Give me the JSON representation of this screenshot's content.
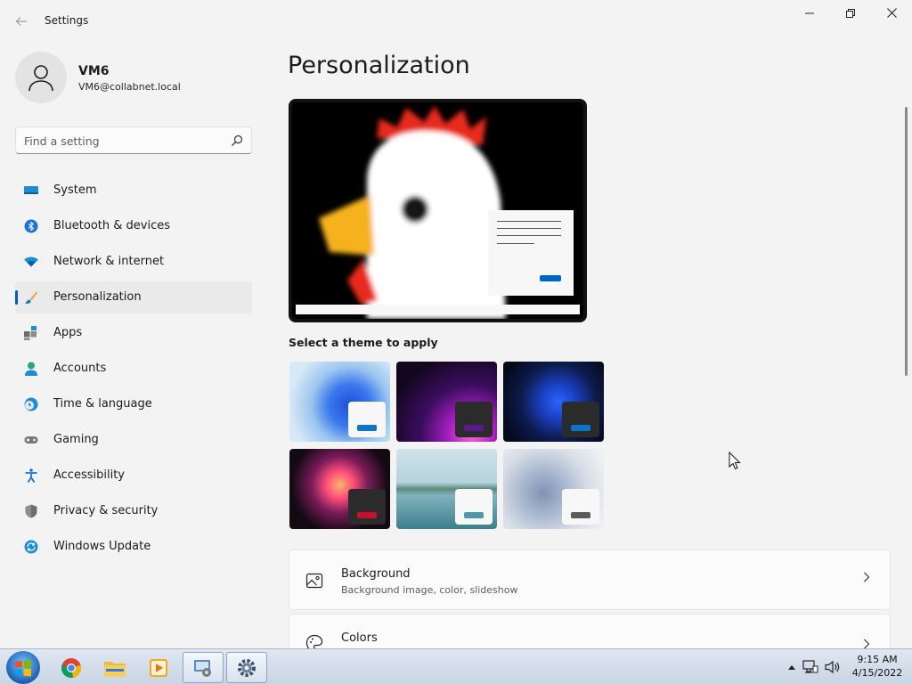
{
  "window": {
    "title": "Settings",
    "back_icon": "back-arrow-icon",
    "minimize_icon": "minimize-icon",
    "maximize_icon": "restore-icon",
    "close_icon": "close-icon"
  },
  "profile": {
    "name": "VM6",
    "email": "VM6@collabnet.local"
  },
  "search": {
    "placeholder": "Find a setting",
    "value": ""
  },
  "sidebar": {
    "items": [
      {
        "label": "System",
        "icon": "system-icon",
        "active": false
      },
      {
        "label": "Bluetooth & devices",
        "icon": "bluetooth-icon",
        "active": false
      },
      {
        "label": "Network & internet",
        "icon": "wifi-icon",
        "active": false
      },
      {
        "label": "Personalization",
        "icon": "brush-icon",
        "active": true
      },
      {
        "label": "Apps",
        "icon": "apps-icon",
        "active": false
      },
      {
        "label": "Accounts",
        "icon": "person-icon",
        "active": false
      },
      {
        "label": "Time & language",
        "icon": "clock-globe-icon",
        "active": false
      },
      {
        "label": "Gaming",
        "icon": "gamepad-icon",
        "active": false
      },
      {
        "label": "Accessibility",
        "icon": "accessibility-icon",
        "active": false
      },
      {
        "label": "Privacy & security",
        "icon": "shield-icon",
        "active": false
      },
      {
        "label": "Windows Update",
        "icon": "update-icon",
        "active": false
      }
    ]
  },
  "main": {
    "title": "Personalization",
    "theme_heading": "Select a theme to apply",
    "themes": [
      {
        "name": "theme-windows-light",
        "accent": "#0a74c9"
      },
      {
        "name": "theme-glow",
        "accent": "#5b1a8a"
      },
      {
        "name": "theme-windows-dark",
        "accent": "#0a74c9"
      },
      {
        "name": "theme-captured-motion",
        "accent": "#c8102e"
      },
      {
        "name": "theme-sunrise-lake",
        "accent": "#4a9aa8"
      },
      {
        "name": "theme-flow",
        "accent": "#5a5a5a"
      }
    ],
    "cards": [
      {
        "title": "Background",
        "subtitle": "Background image, color, slideshow",
        "icon": "picture-icon"
      },
      {
        "title": "Colors",
        "subtitle": "",
        "icon": "palette-icon"
      }
    ]
  },
  "taskbar": {
    "apps": [
      "start-orb-icon",
      "chrome-icon",
      "file-explorer-icon",
      "media-player-icon",
      "remote-desktop-icon",
      "settings-gear-icon"
    ],
    "time": "9:15 AM",
    "date": "4/15/2022"
  },
  "colors": {
    "accent": "#005fb8",
    "window_bg": "#f3f3f3",
    "card_bg": "#fbfbfb"
  }
}
